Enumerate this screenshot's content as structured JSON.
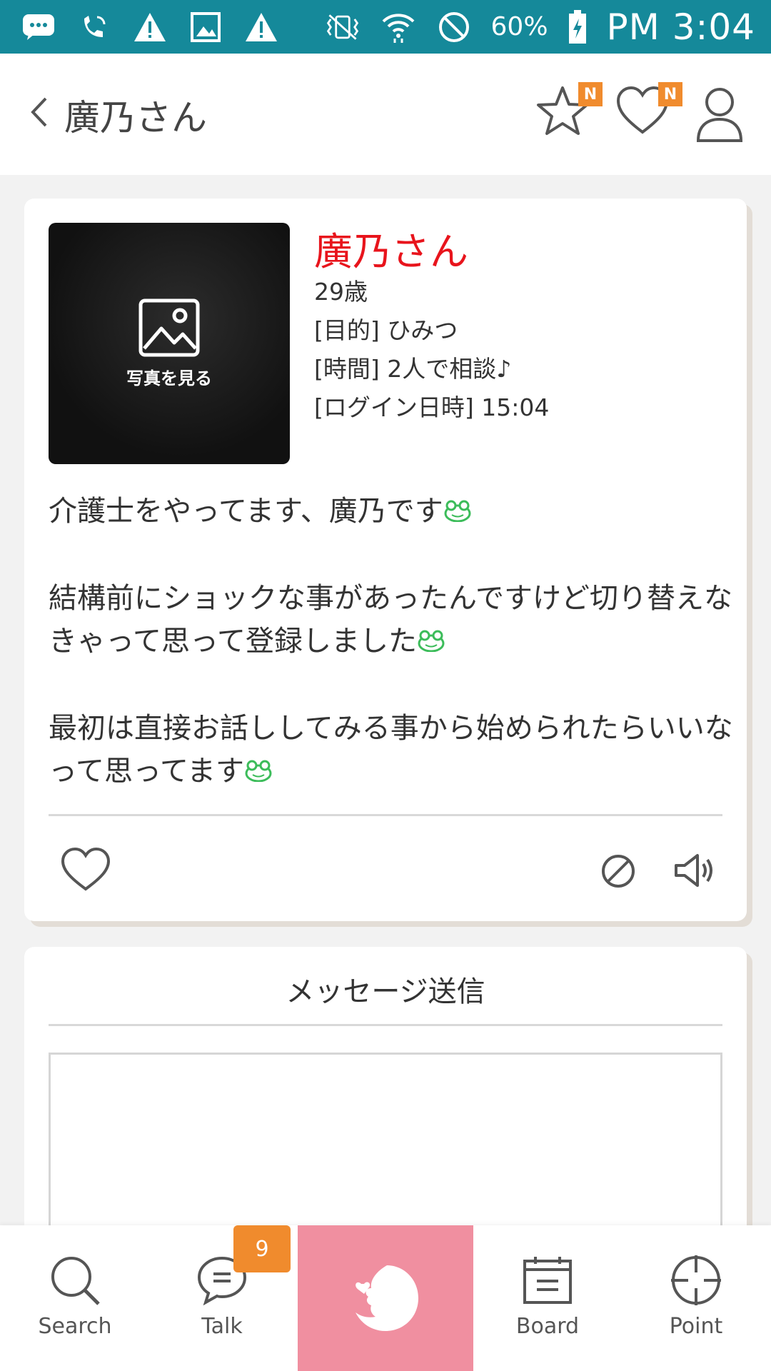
{
  "status_bar": {
    "battery": "60%",
    "time": "PM 3:04",
    "icons": [
      "chat-notification-icon",
      "wifi-calling-icon",
      "warning-icon",
      "image-icon",
      "warning-icon",
      "vibrate-icon",
      "wifi-icon",
      "do-not-disturb-icon",
      "battery-charging-icon"
    ]
  },
  "header": {
    "title": "廣乃さん",
    "star_badge": "N",
    "heart_badge": "N"
  },
  "profile": {
    "photo_label": "写真を見る",
    "name": "廣乃さん",
    "age": "29歳",
    "purpose": "[目的] ひみつ",
    "time": "[時間] 2人で相談♪",
    "login": "[ログイン日時] 15:04",
    "bio": [
      "介護士をやってます、廣乃です",
      "",
      "結構前にショックな事があったんですけど切り替えなきゃって思って登録しました",
      "",
      "最初は直接お話ししてみる事から始められたらいいなって思ってます"
    ]
  },
  "message": {
    "title": "メッセージ送信",
    "body": ""
  },
  "bottom_nav": {
    "search": "Search",
    "talk": "Talk",
    "talk_badge": "9",
    "board": "Board",
    "point": "Point"
  },
  "colors": {
    "status_bar": "#15899a",
    "name": "#e8141c",
    "badge": "#f08b2d",
    "center_nav": "#f08fa0"
  }
}
